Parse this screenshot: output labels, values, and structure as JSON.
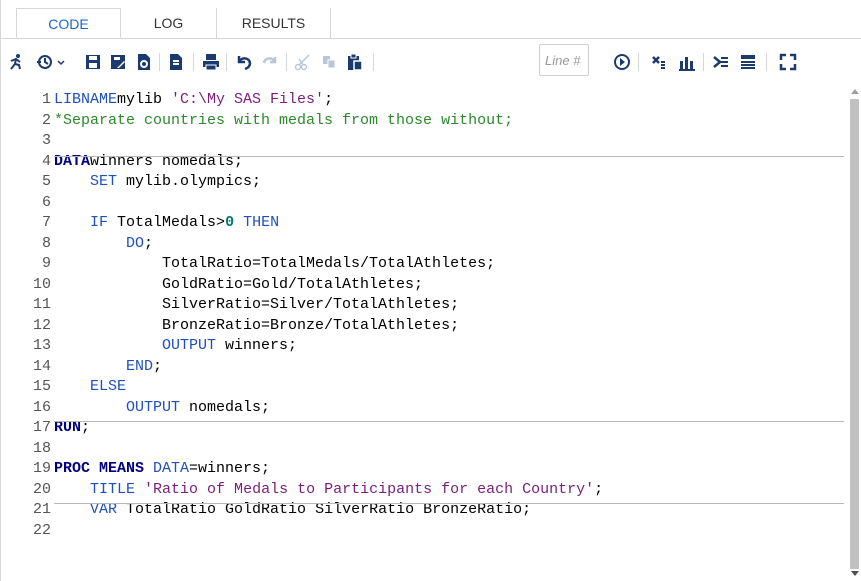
{
  "tabs": [
    {
      "label": "CODE",
      "active": true
    },
    {
      "label": "LOG",
      "active": false
    },
    {
      "label": "RESULTS",
      "active": false
    }
  ],
  "toolbar": {
    "icons": [
      "run-icon",
      "history-icon",
      "save-icon",
      "save-as-icon",
      "open-file-icon",
      "submit-selection-icon",
      "print-icon",
      "undo-icon",
      "redo-icon",
      "cut-icon",
      "copy-icon",
      "paste-icon",
      "go-icon",
      "clear-icon",
      "format-icon",
      "code-snippet-icon",
      "split-icon",
      "maximize-icon"
    ],
    "line_placeholder": "Line #"
  },
  "colors": {
    "tab_active": "#1f66c9",
    "keyword": "#1f4fbf",
    "keyword_bold": "#000080",
    "string": "#7a1e7a",
    "comment": "#2a8a2a",
    "number": "#00796b",
    "toolbar_icon": "#1b3b6f"
  },
  "editor": {
    "lines": [
      {
        "n": "1",
        "tokens": [
          [
            "kw",
            "LIBNAME"
          ],
          [
            "",
            "mylib "
          ],
          [
            "str",
            "'C:\\My SAS Files'"
          ],
          [
            "",
            ";"
          ]
        ]
      },
      {
        "n": "2",
        "tokens": [
          [
            "cmt",
            "*Separate countries with medals from those without;"
          ]
        ]
      },
      {
        "n": "3",
        "tokens": []
      },
      {
        "n": "4",
        "tokens": [
          [
            "kwb",
            "DATA"
          ],
          [
            "",
            "winners nomedals;"
          ]
        ]
      },
      {
        "n": "5",
        "tokens": [
          [
            "",
            "    "
          ],
          [
            "kw",
            "SET"
          ],
          [
            "",
            " mylib.olympics;"
          ]
        ]
      },
      {
        "n": "6",
        "tokens": []
      },
      {
        "n": "7",
        "tokens": [
          [
            "",
            "    "
          ],
          [
            "kw",
            "IF"
          ],
          [
            "",
            " TotalMedals>"
          ],
          [
            "num",
            "0"
          ],
          [
            "",
            " "
          ],
          [
            "kw",
            "THEN"
          ]
        ]
      },
      {
        "n": "8",
        "tokens": [
          [
            "",
            "        "
          ],
          [
            "kw",
            "DO"
          ],
          [
            "",
            ";"
          ]
        ]
      },
      {
        "n": "9",
        "tokens": [
          [
            "",
            "            TotalRatio=TotalMedals/TotalAthletes;"
          ]
        ]
      },
      {
        "n": "10",
        "tokens": [
          [
            "",
            "            GoldRatio=Gold/TotalAthletes;"
          ]
        ]
      },
      {
        "n": "11",
        "tokens": [
          [
            "",
            "            SilverRatio=Silver/TotalAthletes;"
          ]
        ]
      },
      {
        "n": "12",
        "tokens": [
          [
            "",
            "            BronzeRatio=Bronze/TotalAthletes;"
          ]
        ]
      },
      {
        "n": "13",
        "tokens": [
          [
            "",
            "            "
          ],
          [
            "kw",
            "OUTPUT"
          ],
          [
            "",
            " winners;"
          ]
        ]
      },
      {
        "n": "14",
        "tokens": [
          [
            "",
            "        "
          ],
          [
            "kw",
            "END"
          ],
          [
            "",
            ";"
          ]
        ]
      },
      {
        "n": "15",
        "tokens": [
          [
            "",
            "    "
          ],
          [
            "kw",
            "ELSE"
          ]
        ]
      },
      {
        "n": "16",
        "tokens": [
          [
            "",
            "        "
          ],
          [
            "kw",
            "OUTPUT"
          ],
          [
            "",
            " nomedals;"
          ]
        ]
      },
      {
        "n": "17",
        "tokens": [
          [
            "kwb",
            "RUN"
          ],
          [
            "",
            ";"
          ]
        ]
      },
      {
        "n": "18",
        "tokens": []
      },
      {
        "n": "19",
        "tokens": [
          [
            "kwb",
            "PROC MEANS"
          ],
          [
            "",
            " "
          ],
          [
            "kw",
            "DATA"
          ],
          [
            "",
            "=winners;"
          ]
        ]
      },
      {
        "n": "20",
        "tokens": [
          [
            "",
            "    "
          ],
          [
            "kw",
            "TITLE"
          ],
          [
            "",
            " "
          ],
          [
            "str",
            "'Ratio of Medals to Participants for each Country'"
          ],
          [
            "",
            ";"
          ]
        ]
      },
      {
        "n": "21",
        "tokens": [
          [
            "",
            "    "
          ],
          [
            "kw",
            "VAR"
          ],
          [
            "",
            " TotalRatio GoldRatio SilverRatio BronzeRatio;"
          ]
        ]
      },
      {
        "n": "22",
        "tokens": []
      }
    ]
  }
}
